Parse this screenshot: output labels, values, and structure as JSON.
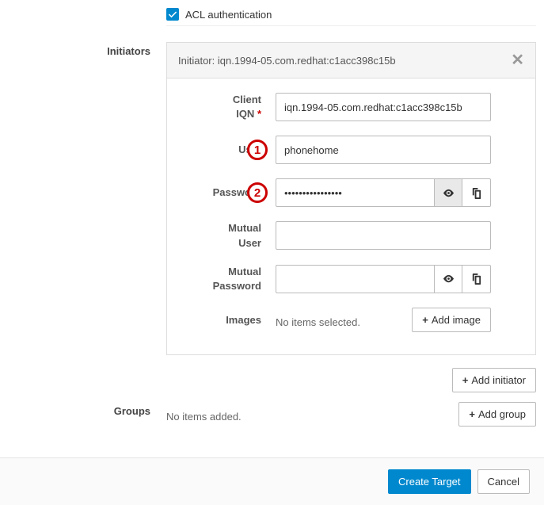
{
  "acl": {
    "label": "ACL authentication",
    "checked": true
  },
  "sections": {
    "initiators_label": "Initiators",
    "groups_label": "Groups"
  },
  "initiator": {
    "header_prefix": "Initiator: ",
    "header_value": "iqn.1994-05.com.redhat:c1acc398c15b",
    "fields": {
      "client_iqn": {
        "label": "Client\nIQN",
        "value": "iqn.1994-05.com.redhat:c1acc398c15b",
        "required": true
      },
      "user": {
        "label": "User",
        "value": "phonehome"
      },
      "password": {
        "label": "Password",
        "value": "••••••••••••••••"
      },
      "mutual_user": {
        "label": "Mutual\nUser",
        "value": ""
      },
      "mutual_password": {
        "label": "Mutual\nPassword",
        "value": ""
      },
      "images": {
        "label": "Images",
        "empty": "No items selected.",
        "add_button": "Add image"
      }
    },
    "add_button": "Add initiator"
  },
  "groups": {
    "empty": "No items added.",
    "add_button": "Add group"
  },
  "callouts": {
    "c1": "1",
    "c2": "2"
  },
  "footer": {
    "primary": "Create Target",
    "cancel": "Cancel"
  },
  "icons": {
    "eye": "eye-icon",
    "copy": "copy-icon",
    "close": "close-icon",
    "check": "check-icon",
    "plus": "+"
  }
}
